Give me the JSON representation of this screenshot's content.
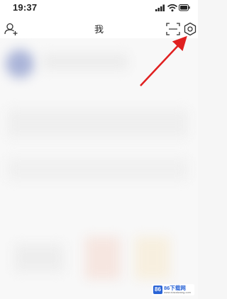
{
  "status_bar": {
    "time": "19:37",
    "icons": [
      "signal-icon",
      "wifi-icon",
      "battery-icon"
    ]
  },
  "nav_bar": {
    "title": "我",
    "left_icon": "add-friend-icon",
    "right_icons": [
      "scan-icon",
      "settings-icon"
    ]
  },
  "watermark": {
    "logo": "86",
    "text": "86下载网",
    "subtext": "www.xiazaiwang.com"
  },
  "annotation": {
    "type": "arrow",
    "color": "#e02020",
    "points_to": "settings-icon"
  }
}
